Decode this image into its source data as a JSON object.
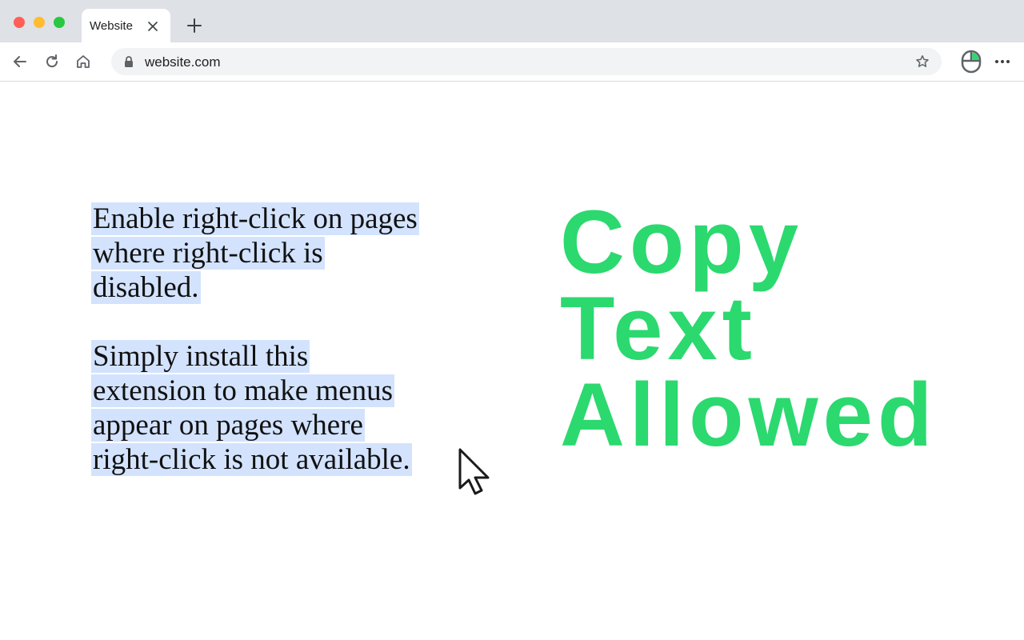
{
  "window": {
    "traffic_lights": {
      "close_color": "#ff5f57",
      "minimize_color": "#febc2e",
      "maximize_color": "#28c840"
    }
  },
  "tab": {
    "title": "Website",
    "close_icon": "close-icon"
  },
  "new_tab_icon": "plus-icon",
  "toolbar": {
    "back_icon": "arrow-left-icon",
    "reload_icon": "reload-icon",
    "home_icon": "home-icon",
    "url": "website.com",
    "lock_icon": "lock-icon",
    "bookmark_icon": "star-icon",
    "extension_icon": "mouse-icon",
    "menu_icon": "more-horizontal-icon"
  },
  "page": {
    "paragraph1": {
      "lines": [
        "Enable right-click on pages ",
        "where right-click is ",
        "disabled. "
      ]
    },
    "paragraph2": {
      "lines": [
        "Simply install this ",
        "extension to make menus ",
        "appear on pages where ",
        "right-click is not available."
      ]
    },
    "hero": {
      "lines": [
        "Copy",
        "Text",
        "Allowed"
      ]
    },
    "selection_color": "#d3e3fd",
    "hero_color": "#2bd96f"
  }
}
